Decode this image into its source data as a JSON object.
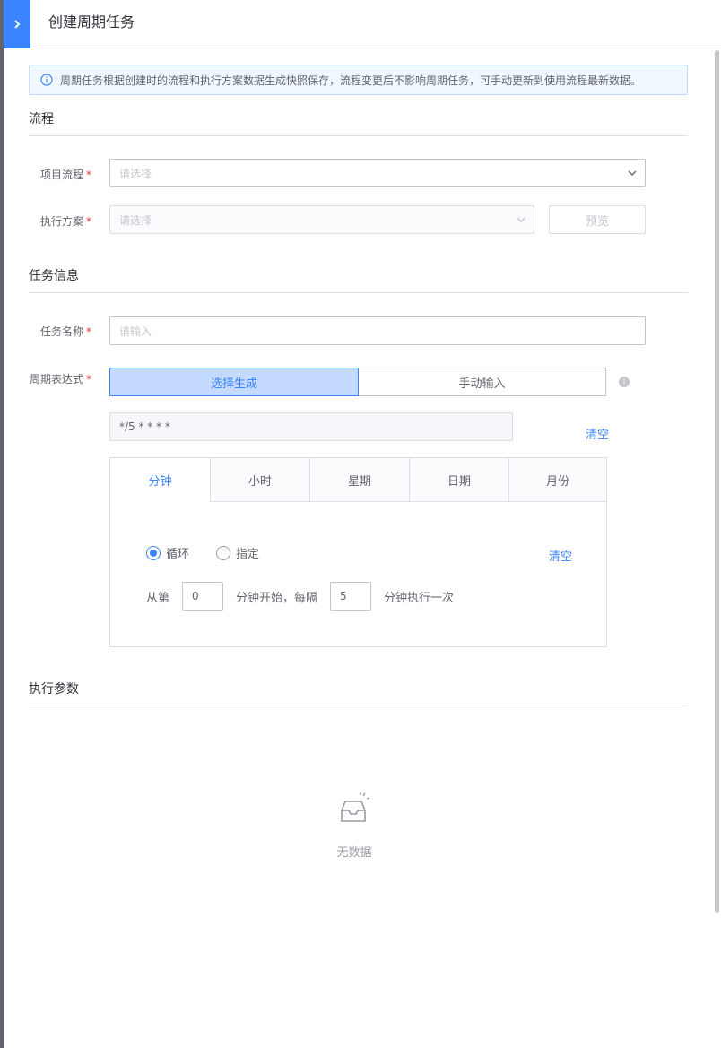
{
  "header": {
    "title": "创建周期任务"
  },
  "notice": {
    "text": "周期任务根据创建时的流程和执行方案数据生成快照保存，流程变更后不影响周期任务，可手动更新到使用流程最新数据。"
  },
  "sections": {
    "flow": "流程",
    "task_info": "任务信息",
    "params": "执行参数"
  },
  "form": {
    "project_flow": {
      "label": "项目流程",
      "required": "*",
      "placeholder": "请选择"
    },
    "exec_plan": {
      "label": "执行方案",
      "required": "*",
      "placeholder": "请选择"
    },
    "preview_label": "预览",
    "task_name": {
      "label": "任务名称",
      "required": "*",
      "placeholder": "请输入"
    },
    "cron": {
      "label": "周期表达式",
      "required": "*",
      "mode_select": "选择生成",
      "mode_manual": "手动输入",
      "info": "i",
      "expression": "*/5 * * * *",
      "clear_label": "清空"
    }
  },
  "cron_tabs": {
    "tabs": [
      "分钟",
      "小时",
      "星期",
      "日期",
      "月份"
    ],
    "active": 0,
    "radio_loop": "循环",
    "radio_specify": "指定",
    "clear_label": "清空",
    "rule": {
      "prefix": "从第",
      "start_value": "0",
      "middle": "分钟开始，每隔",
      "interval_value": "5",
      "suffix": "分钟执行一次"
    }
  },
  "empty": {
    "text": "无数据"
  },
  "colors": {
    "primary": "#3a84ff",
    "required": "#ea3636",
    "border": "#c4c6cc"
  }
}
